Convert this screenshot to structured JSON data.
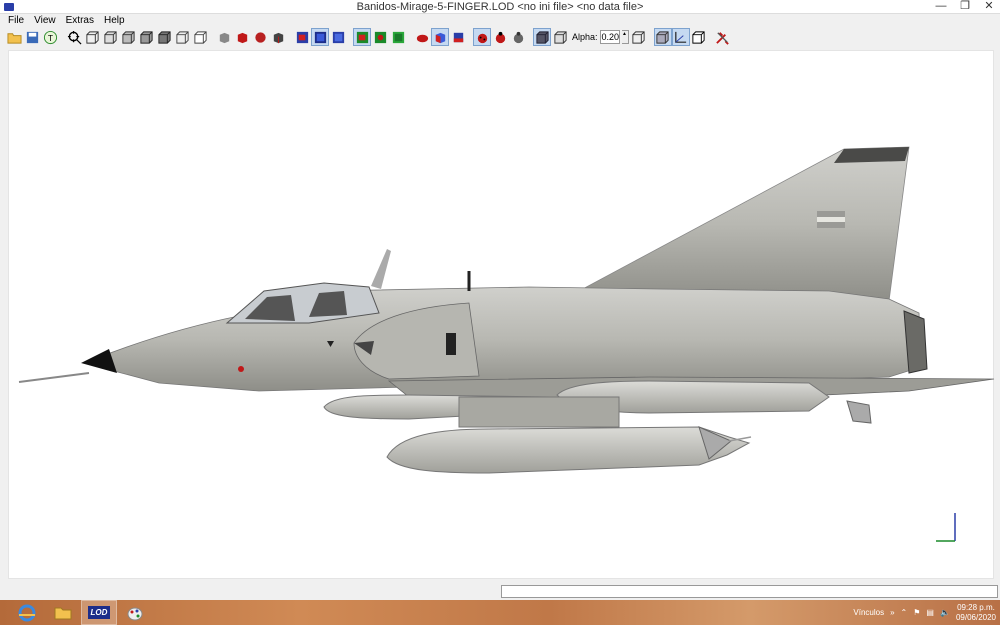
{
  "window": {
    "title": "Banidos-Mirage-5-FINGER.LOD  <no ini file>  <no data file>",
    "minimize_glyph": "—",
    "restore_glyph": "❐",
    "close_glyph": "✕"
  },
  "menu": [
    "File",
    "View",
    "Extras",
    "Help"
  ],
  "toolbar": {
    "alpha_label": "Alpha:",
    "alpha_value": "0.20",
    "spin_up": "▲",
    "spin_down": "▼",
    "icons": [
      "open-folder-icon",
      "save-disk-icon",
      "texture-t-icon",
      "zoom-target-icon",
      "wire-cube-1-icon",
      "wire-cube-2-icon",
      "wire-cube-3-icon",
      "wire-cube-4-icon",
      "wire-cube-5-icon",
      "wire-cube-6-icon",
      "wire-cube-7-icon",
      "solid-grey-cube-icon",
      "solid-red-cube-icon",
      "red-sphere-cube-icon",
      "dark-cube-icon",
      "blue-frame-1-icon",
      "blue-frame-2-icon",
      "blue-frame-3-icon",
      "green-frame-1-icon",
      "green-frame-2-icon",
      "green-frame-3-icon",
      "red-bird-icon",
      "multicolor-cube-icon",
      "blue-cube-icon",
      "ladybug-1-icon",
      "ladybug-2-icon",
      "grey-bird-icon",
      "shaded-box-icon",
      "outline-box-icon"
    ]
  },
  "taskbar": {
    "vinculos_label": "Vínculos",
    "time": "09:28 p.m.",
    "date": "09/06/2020",
    "lod_label": "LOD"
  },
  "colors": {
    "taskbar_base": "#c07848",
    "accent_blue": "#2a3ea8"
  }
}
